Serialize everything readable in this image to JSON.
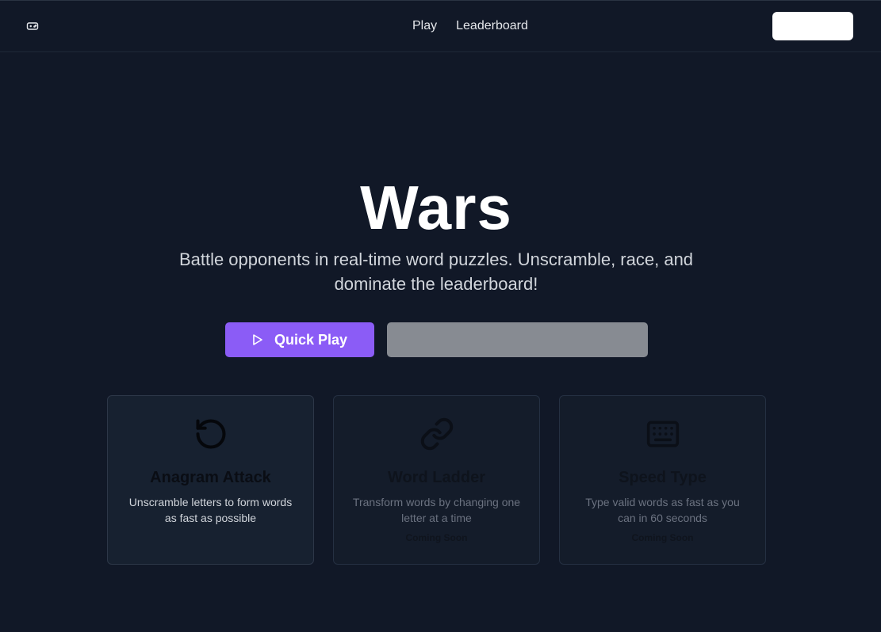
{
  "nav": {
    "logo_icon": "gamepad-icon",
    "links": [
      "Play",
      "Leaderboard"
    ],
    "signin_label": ""
  },
  "hero": {
    "title": "Wars",
    "subtitle": "Battle opponents in real-time word puzzles. Unscramble, race, and dominate the leaderboard!",
    "quick_play_label": "Quick Play",
    "secondary_label": ""
  },
  "modes": [
    {
      "icon": "rotate-ccw-icon",
      "title": "Anagram Attack",
      "desc": "Unscramble letters to form words as fast as possible",
      "status": ""
    },
    {
      "icon": "link-icon",
      "title": "Word Ladder",
      "desc": "Transform words by changing one letter at a time",
      "status": "Coming Soon"
    },
    {
      "icon": "keyboard-icon",
      "title": "Speed Type",
      "desc": "Type valid words as fast as you can in 60 seconds",
      "status": "Coming Soon"
    }
  ],
  "colors": {
    "background": "#111827",
    "accent": "#8b5cf6",
    "secondary_button": "#878b92"
  }
}
